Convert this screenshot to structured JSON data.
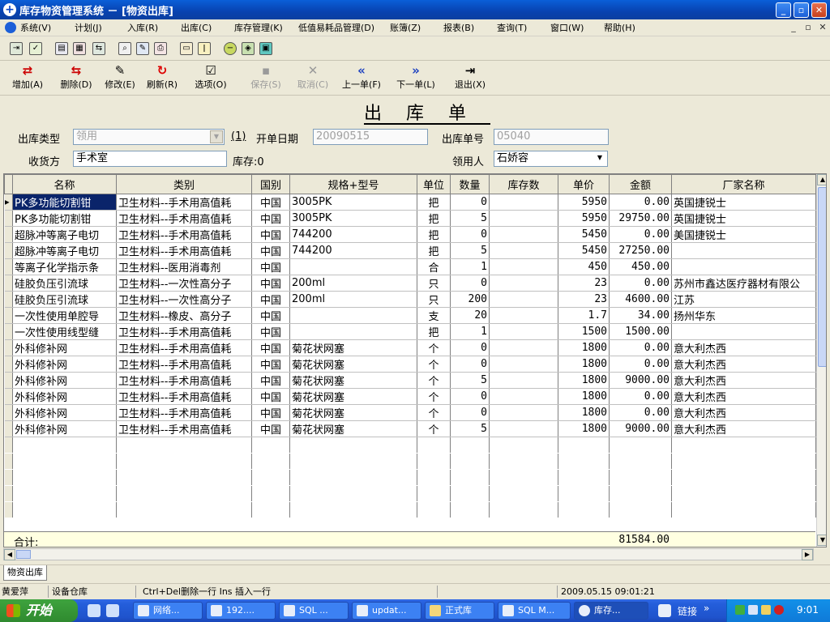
{
  "titlebar": {
    "title": "库存物资管理系统 － [物资出库]"
  },
  "menu": [
    "系统(V)",
    "计划(J)",
    "入库(R)",
    "出库(C)",
    "库存管理(K)",
    "低值易耗品管理(D)",
    "账簿(Z)",
    "报表(B)",
    "查询(T)",
    "窗口(W)",
    "帮助(H)"
  ],
  "actions": [
    {
      "label": "增加(A)",
      "icon": "add-icon"
    },
    {
      "label": "删除(D)",
      "icon": "delete-icon"
    },
    {
      "label": "修改(E)",
      "icon": "edit-icon"
    },
    {
      "label": "刷新(R)",
      "icon": "refresh-icon"
    },
    {
      "label": "选项(O)",
      "icon": "options-icon"
    },
    {
      "label": "保存(S)",
      "icon": "save-icon"
    },
    {
      "label": "取消(C)",
      "icon": "cancel-icon"
    },
    {
      "label": "上一单(F)",
      "icon": "prev-icon"
    },
    {
      "label": "下一单(L)",
      "icon": "next-icon"
    },
    {
      "label": "退出(X)",
      "icon": "exit-icon"
    }
  ],
  "form": {
    "heading": "出库单",
    "type_label": "出库类型",
    "type_value": "领用",
    "type_index": "(1)",
    "date_label": "开单日期",
    "date_value": "20090515",
    "no_label": "出库单号",
    "no_value": "05040",
    "receiver_label": "收货方",
    "receiver_value": "手术室",
    "stock_label": "库存:0",
    "recipient_label": "领用人",
    "recipient_value": "石娇容"
  },
  "table": {
    "columns": [
      "名称",
      "类别",
      "国别",
      "规格+型号",
      "单位",
      "数量",
      "库存数",
      "单价",
      "金额",
      "厂家名称"
    ],
    "rows": [
      [
        "PK多功能切割钳",
        "卫生材料--手术用高值耗",
        "中国",
        "3005PK",
        "把",
        "0",
        "",
        "5950",
        "0.00",
        "英国捷锐士"
      ],
      [
        "PK多功能切割钳",
        "卫生材料--手术用高值耗",
        "中国",
        "3005PK",
        "把",
        "5",
        "",
        "5950",
        "29750.00",
        "英国捷锐士"
      ],
      [
        "超脉冲等离子电切",
        "卫生材料--手术用高值耗",
        "中国",
        "744200",
        "把",
        "0",
        "",
        "5450",
        "0.00",
        "美国捷锐士"
      ],
      [
        "超脉冲等离子电切",
        "卫生材料--手术用高值耗",
        "中国",
        "744200",
        "把",
        "5",
        "",
        "5450",
        "27250.00",
        ""
      ],
      [
        "等离子化学指示条",
        "卫生材料--医用消毒剂",
        "中国",
        "",
        "合",
        "1",
        "",
        "450",
        "450.00",
        ""
      ],
      [
        "硅胶负压引流球",
        "卫生材料--一次性高分子",
        "中国",
        "200ml",
        "只",
        "0",
        "",
        "23",
        "0.00",
        "苏州市鑫达医疗器材有限公"
      ],
      [
        "硅胶负压引流球",
        "卫生材料--一次性高分子",
        "中国",
        "200ml",
        "只",
        "200",
        "",
        "23",
        "4600.00",
        "江苏"
      ],
      [
        "一次性使用单腔导",
        "卫生材料--橡皮、高分子",
        "中国",
        "",
        "支",
        "20",
        "",
        "1.7",
        "34.00",
        "扬州华东"
      ],
      [
        "一次性使用线型缝",
        "卫生材料--手术用高值耗",
        "中国",
        "",
        "把",
        "1",
        "",
        "1500",
        "1500.00",
        ""
      ],
      [
        "外科修补网",
        "卫生材料--手术用高值耗",
        "中国",
        "菊花状网塞",
        "个",
        "0",
        "",
        "1800",
        "0.00",
        "意大利杰西"
      ],
      [
        "外科修补网",
        "卫生材料--手术用高值耗",
        "中国",
        "菊花状网塞",
        "个",
        "0",
        "",
        "1800",
        "0.00",
        "意大利杰西"
      ],
      [
        "外科修补网",
        "卫生材料--手术用高值耗",
        "中国",
        "菊花状网塞",
        "个",
        "5",
        "",
        "1800",
        "9000.00",
        "意大利杰西"
      ],
      [
        "外科修补网",
        "卫生材料--手术用高值耗",
        "中国",
        "菊花状网塞",
        "个",
        "0",
        "",
        "1800",
        "0.00",
        "意大利杰西"
      ],
      [
        "外科修补网",
        "卫生材料--手术用高值耗",
        "中国",
        "菊花状网塞",
        "个",
        "0",
        "",
        "1800",
        "0.00",
        "意大利杰西"
      ],
      [
        "外科修补网",
        "卫生材料--手术用高值耗",
        "中国",
        "菊花状网塞",
        "个",
        "5",
        "",
        "1800",
        "9000.00",
        "意大利杰西"
      ]
    ],
    "total_label": "合计:",
    "total_value": "81584.00"
  },
  "tab": "物资出库",
  "status": [
    "黄爱萍",
    "设备仓库",
    "Ctrl+Del删除一行  Ins 插入一行",
    "",
    "2009.05.15 09:01:21"
  ],
  "taskbar": {
    "start": "开始",
    "tasks": [
      "网络...",
      "192....",
      "SQL ...",
      "updat...",
      "正式库",
      "SQL M...",
      "库存..."
    ],
    "links": "链接",
    "clock": "9:01"
  },
  "colors": {
    "title": "#0a46c8",
    "selection": "#0a246a",
    "total_bg": "#ffffe1",
    "taskbar": "#245edb"
  }
}
